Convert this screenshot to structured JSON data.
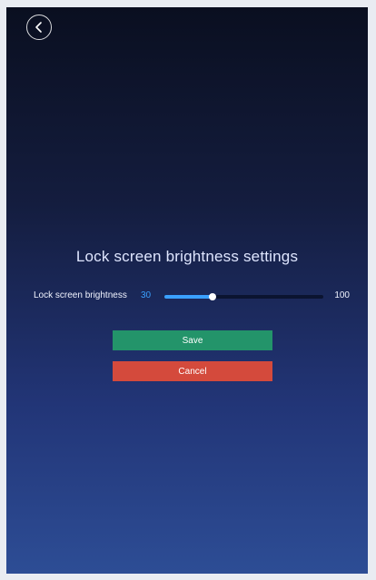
{
  "header": {
    "back_icon": "chevron-left-circle-icon"
  },
  "page": {
    "title": "Lock screen brightness settings"
  },
  "brightness": {
    "label": "Lock screen brightness",
    "value": "30",
    "max_label": "100",
    "level": 0.3
  },
  "actions": {
    "save_label": "Save",
    "cancel_label": "Cancel"
  },
  "colors": {
    "accent": "#3aa0ff",
    "save": "#23946a",
    "cancel": "#d44a3c"
  }
}
